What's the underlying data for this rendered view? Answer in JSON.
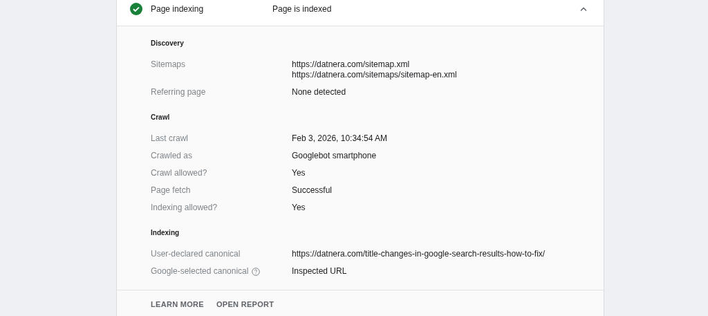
{
  "panel": {
    "title": "Page indexing",
    "status": "Page is indexed",
    "kind": "valid",
    "expanded": true
  },
  "sections": [
    {
      "heading": "Discovery",
      "rows": [
        {
          "label": "Sitemaps",
          "values": [
            "https://datnera.com/sitemap.xml",
            "https://datnera.com/sitemaps/sitemap-en.xml"
          ],
          "help": false
        },
        {
          "label": "Referring page",
          "values": [
            "None detected"
          ],
          "help": false
        }
      ]
    },
    {
      "heading": "Crawl",
      "rows": [
        {
          "label": "Last crawl",
          "values": [
            "Feb 3, 2026, 10:34:54 AM"
          ],
          "help": false
        },
        {
          "label": "Crawled as",
          "values": [
            "Googlebot smartphone"
          ],
          "help": false
        },
        {
          "label": "Crawl allowed?",
          "values": [
            "Yes"
          ],
          "help": false
        },
        {
          "label": "Page fetch",
          "values": [
            "Successful"
          ],
          "help": false
        },
        {
          "label": "Indexing allowed?",
          "values": [
            "Yes"
          ],
          "help": false
        }
      ]
    },
    {
      "heading": "Indexing",
      "rows": [
        {
          "label": "User-declared canonical",
          "values": [
            "https://datnera.com/title-changes-in-google-search-results-how-to-fix/"
          ],
          "help": false
        },
        {
          "label": "Google-selected canonical",
          "values": [
            "Inspected URL"
          ],
          "help": true
        }
      ]
    }
  ],
  "footer_buttons": [
    "LEARN MORE",
    "OPEN REPORT"
  ]
}
